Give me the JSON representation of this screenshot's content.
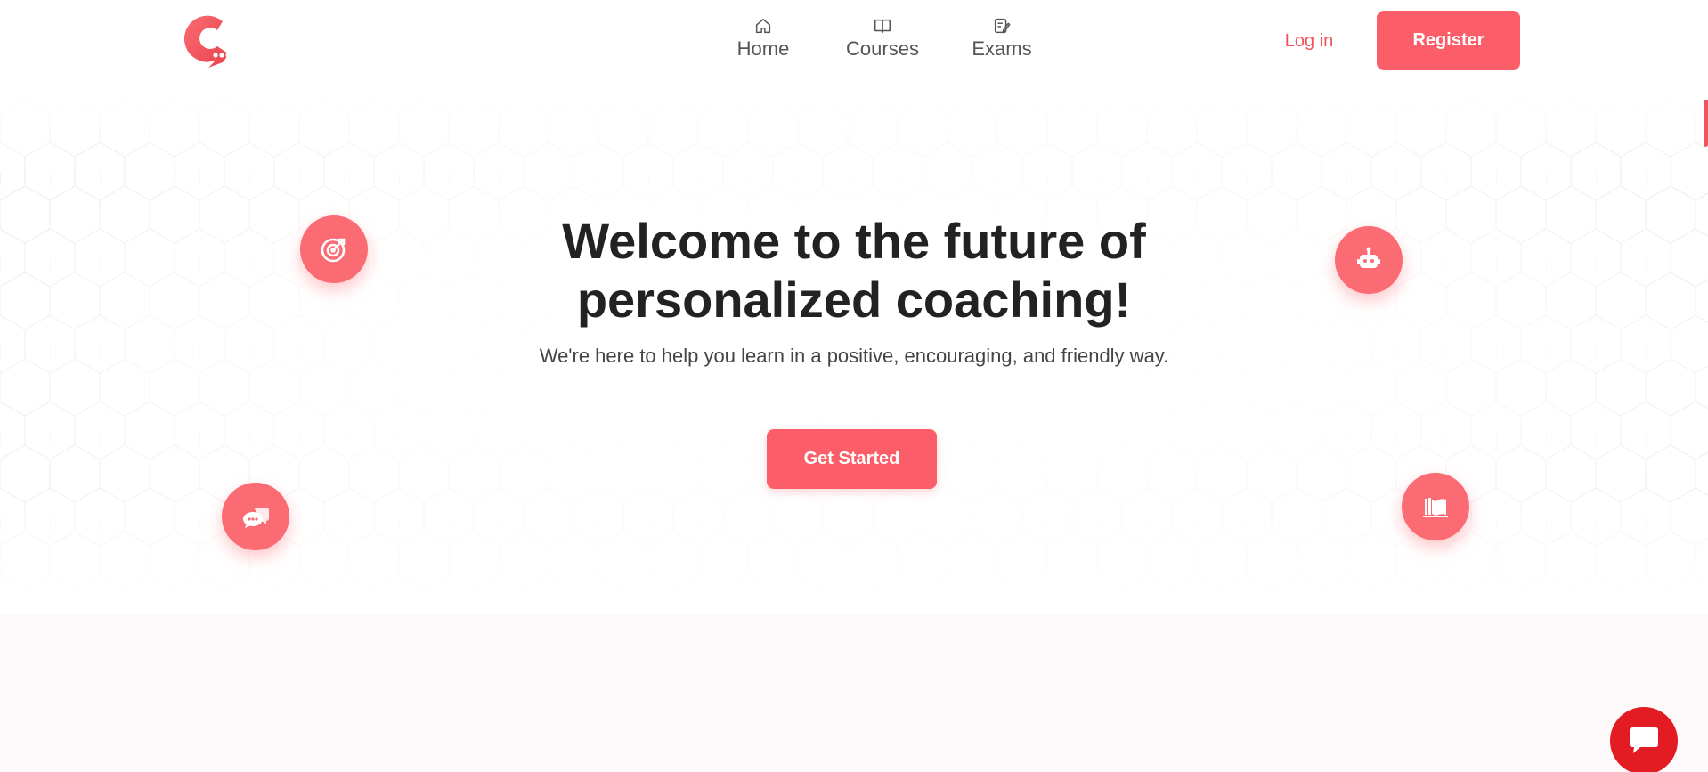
{
  "brand": {
    "accent": "#fb5e68",
    "logo_icon": "chat-c-logo"
  },
  "nav": {
    "items": [
      {
        "label": "Home",
        "icon": "home-icon"
      },
      {
        "label": "Courses",
        "icon": "book-icon"
      },
      {
        "label": "Exams",
        "icon": "exam-icon"
      }
    ],
    "login_label": "Log in",
    "register_label": "Register"
  },
  "hero": {
    "title_line1": "Welcome to the future of",
    "title_line2": "personalized coaching!",
    "subtitle": "We're here to help you learn in a positive, encouraging, and friendly way.",
    "cta_label": "Get Started",
    "bubbles": [
      "target-icon",
      "robot-icon",
      "chat-bubbles-icon",
      "open-book-icon"
    ]
  },
  "section2": {
    "heading_partial": ""
  },
  "chat_widget": {
    "icon": "chat-icon",
    "color": "#e31b23"
  }
}
